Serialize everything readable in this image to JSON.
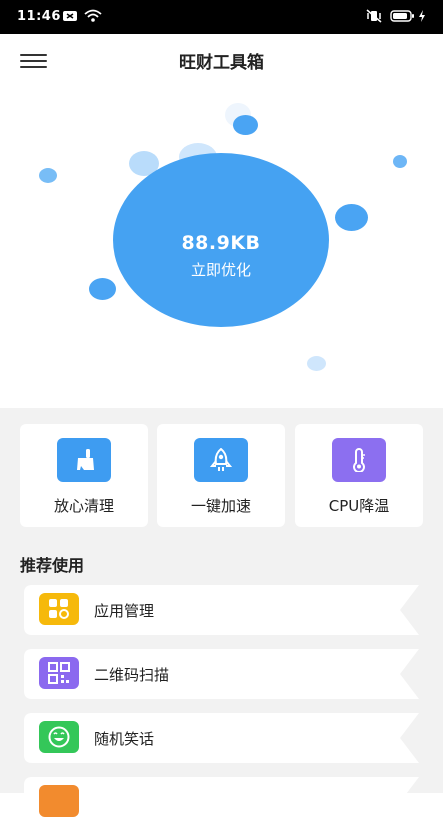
{
  "status_bar": {
    "time": "11:46"
  },
  "header": {
    "title": "旺财工具箱"
  },
  "hero": {
    "size_text": "88.9KB",
    "action_text": "立即优化"
  },
  "tools": [
    {
      "label": "放心清理",
      "icon": "broom-icon",
      "color": "#3e9cf1"
    },
    {
      "label": "一键加速",
      "icon": "rocket-icon",
      "color": "#3e9cf1"
    },
    {
      "label": "CPU降温",
      "icon": "thermometer-icon",
      "color": "#8c6ff0"
    }
  ],
  "recommend": {
    "title": "推荐使用",
    "items": [
      {
        "label": "应用管理",
        "icon": "apps-grid-icon",
        "color": "#f6b90b"
      },
      {
        "label": "二维码扫描",
        "icon": "qr-code-icon",
        "color": "#8b69ef"
      },
      {
        "label": "随机笑话",
        "icon": "smile-icon",
        "color": "#34c759"
      },
      {
        "label": "",
        "icon": "app-icon",
        "color": "#f28b2e"
      }
    ]
  },
  "colors": {
    "accent": "#45a2f2",
    "background_lower": "#f2f2f2"
  }
}
